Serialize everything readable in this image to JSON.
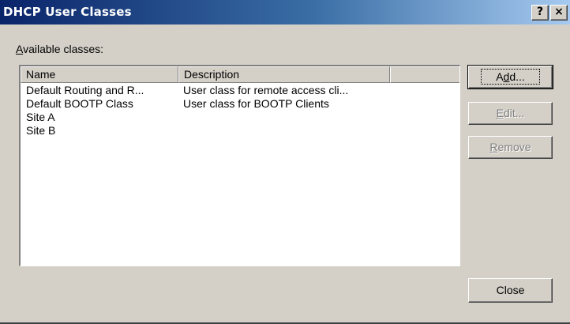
{
  "window": {
    "title": "DHCP User Classes",
    "help_glyph": "?",
    "close_glyph": "×"
  },
  "labels": {
    "available_classes": "Available classes:"
  },
  "list": {
    "columns": [
      "Name",
      "Description",
      ""
    ],
    "rows": [
      {
        "name": "Default Routing and R...",
        "description": "User class for remote access cli..."
      },
      {
        "name": "Default BOOTP Class",
        "description": "User class for BOOTP Clients"
      },
      {
        "name": "Site  A",
        "description": ""
      },
      {
        "name": "Site B",
        "description": ""
      }
    ]
  },
  "buttons": {
    "add": "Add...",
    "edit": "Edit...",
    "remove": "Remove",
    "close": "Close"
  },
  "states": {
    "edit_enabled": false,
    "remove_enabled": false
  },
  "colors": {
    "titlebar_start": "#0a246a",
    "titlebar_end": "#a6caf0",
    "face": "#d4d0c8",
    "disabled_text": "#808080"
  }
}
